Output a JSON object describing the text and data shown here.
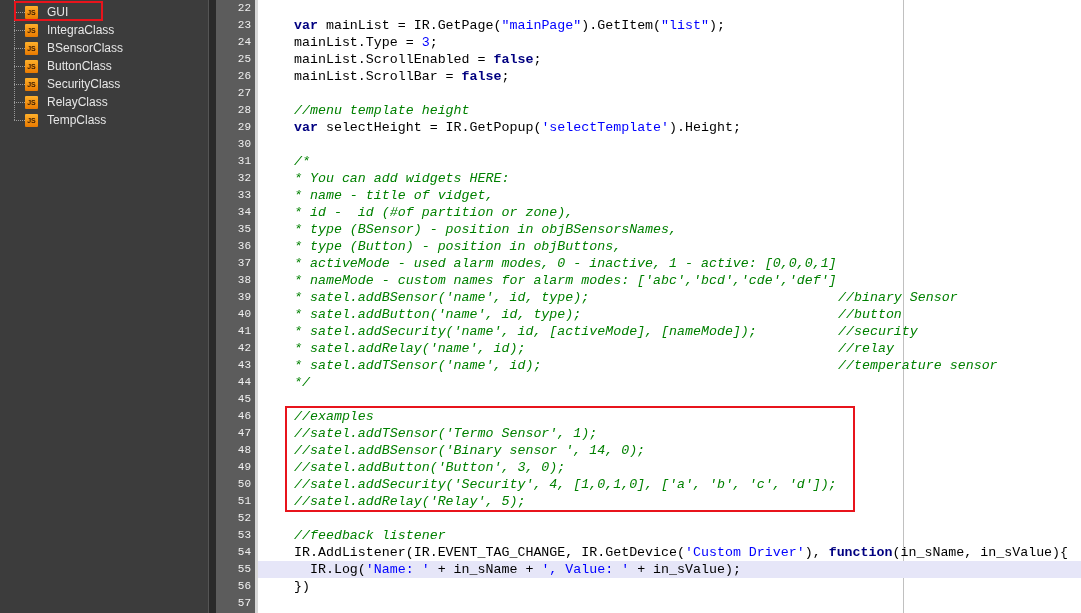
{
  "project_tree": {
    "items": [
      {
        "label": "GUI",
        "icon_text": "JS",
        "boxed": true
      },
      {
        "label": "IntegraClass",
        "icon_text": "JS",
        "boxed": false
      },
      {
        "label": "BSensorClass",
        "icon_text": "JS",
        "boxed": false
      },
      {
        "label": "ButtonClass",
        "icon_text": "JS",
        "boxed": false
      },
      {
        "label": "SecurityClass",
        "icon_text": "JS",
        "boxed": false
      },
      {
        "label": "RelayClass",
        "icon_text": "JS",
        "boxed": false
      },
      {
        "label": "TempClass",
        "icon_text": "JS",
        "boxed": false
      }
    ]
  },
  "editor": {
    "lines": [
      {
        "number": "22",
        "current": false,
        "boxed": false
      },
      {
        "number": "23",
        "current": false,
        "boxed": false,
        "tokens": [
          {
            "kind": "keyword",
            "text": "var"
          },
          {
            "kind": "plain",
            "text": " mainList = IR.GetPage("
          },
          {
            "kind": "string",
            "text": "\"mainPage\""
          },
          {
            "kind": "plain",
            "text": ").GetItem("
          },
          {
            "kind": "string",
            "text": "\"list\""
          },
          {
            "kind": "plain",
            "text": ");"
          }
        ]
      },
      {
        "number": "24",
        "current": false,
        "boxed": false,
        "tokens": [
          {
            "kind": "plain",
            "text": "mainList.Type = "
          },
          {
            "kind": "number",
            "text": "3"
          },
          {
            "kind": "plain",
            "text": ";"
          }
        ]
      },
      {
        "number": "25",
        "current": false,
        "boxed": false,
        "tokens": [
          {
            "kind": "plain",
            "text": "mainList.ScrollEnabled = "
          },
          {
            "kind": "keyword",
            "text": "false"
          },
          {
            "kind": "plain",
            "text": ";"
          }
        ]
      },
      {
        "number": "26",
        "current": false,
        "boxed": false,
        "tokens": [
          {
            "kind": "plain",
            "text": "mainList.ScrollBar = "
          },
          {
            "kind": "keyword",
            "text": "false"
          },
          {
            "kind": "plain",
            "text": ";"
          }
        ]
      },
      {
        "number": "27",
        "current": false,
        "boxed": false
      },
      {
        "number": "28",
        "current": false,
        "boxed": false,
        "tokens": [
          {
            "kind": "comment",
            "text": "//menu template height"
          }
        ]
      },
      {
        "number": "29",
        "current": false,
        "boxed": false,
        "tokens": [
          {
            "kind": "keyword",
            "text": "var"
          },
          {
            "kind": "plain",
            "text": " selectHeight = IR.GetPopup("
          },
          {
            "kind": "string",
            "text": "'selectTemplate'"
          },
          {
            "kind": "plain",
            "text": ").Height;"
          }
        ]
      },
      {
        "number": "30",
        "current": false,
        "boxed": false
      },
      {
        "number": "31",
        "current": false,
        "boxed": false,
        "tokens": [
          {
            "kind": "comment",
            "text": "/*"
          }
        ]
      },
      {
        "number": "32",
        "current": false,
        "boxed": false,
        "tokens": [
          {
            "kind": "comment",
            "text": "* You can add widgets HERE:"
          }
        ]
      },
      {
        "number": "33",
        "current": false,
        "boxed": false,
        "tokens": [
          {
            "kind": "comment",
            "text": "* name - title of vidget,"
          }
        ]
      },
      {
        "number": "34",
        "current": false,
        "boxed": false,
        "tokens": [
          {
            "kind": "comment",
            "text": "* id -  id (#of partition or zone),"
          }
        ]
      },
      {
        "number": "35",
        "current": false,
        "boxed": false,
        "tokens": [
          {
            "kind": "comment",
            "text": "* type (BSensor) - position in objBSensorsNames,"
          }
        ]
      },
      {
        "number": "36",
        "current": false,
        "boxed": false,
        "tokens": [
          {
            "kind": "comment",
            "text": "* type (Button) - position in objButtons,"
          }
        ]
      },
      {
        "number": "37",
        "current": false,
        "boxed": false,
        "tokens": [
          {
            "kind": "comment",
            "text": "* activeMode - used alarm modes, 0 - inactive, 1 - active: [0,0,0,1]"
          }
        ]
      },
      {
        "number": "38",
        "current": false,
        "boxed": false,
        "tokens": [
          {
            "kind": "comment",
            "text": "* nameMode - custom names for alarm modes: ['abc','bcd','cde','def']"
          }
        ]
      },
      {
        "number": "39",
        "current": false,
        "boxed": false,
        "tokens": [
          {
            "kind": "comment",
            "text": "* satel.addBSensor('name', id, type);"
          }
        ],
        "trailing_comment": "//binary Sensor"
      },
      {
        "number": "40",
        "current": false,
        "boxed": false,
        "tokens": [
          {
            "kind": "comment",
            "text": "* satel.addButton('name', id, type);"
          }
        ],
        "trailing_comment": "//button"
      },
      {
        "number": "41",
        "current": false,
        "boxed": false,
        "tokens": [
          {
            "kind": "comment",
            "text": "* satel.addSecurity('name', id, [activeMode], [nameMode]);"
          }
        ],
        "trailing_comment": "//security"
      },
      {
        "number": "42",
        "current": false,
        "boxed": false,
        "tokens": [
          {
            "kind": "comment",
            "text": "* satel.addRelay('name', id);"
          }
        ],
        "trailing_comment": "//relay"
      },
      {
        "number": "43",
        "current": false,
        "boxed": false,
        "tokens": [
          {
            "kind": "comment",
            "text": "* satel.addTSensor('name', id);"
          }
        ],
        "trailing_comment": "//temperature sensor"
      },
      {
        "number": "44",
        "current": false,
        "boxed": false,
        "tokens": [
          {
            "kind": "comment",
            "text": "*/"
          }
        ]
      },
      {
        "number": "45",
        "current": false,
        "boxed": false
      },
      {
        "number": "46",
        "current": false,
        "boxed": true,
        "tokens": [
          {
            "kind": "comment",
            "text": "//examples"
          }
        ]
      },
      {
        "number": "47",
        "current": false,
        "boxed": true,
        "tokens": [
          {
            "kind": "comment",
            "text": "//satel.addTSensor('Termo Sensor', 1);"
          }
        ]
      },
      {
        "number": "48",
        "current": false,
        "boxed": true,
        "tokens": [
          {
            "kind": "comment",
            "text": "//satel.addBSensor('Binary sensor ', 14, 0);"
          }
        ]
      },
      {
        "number": "49",
        "current": false,
        "boxed": true,
        "tokens": [
          {
            "kind": "comment",
            "text": "//satel.addButton('Button', 3, 0);"
          }
        ]
      },
      {
        "number": "50",
        "current": false,
        "boxed": true,
        "tokens": [
          {
            "kind": "comment",
            "text": "//satel.addSecurity('Security', 4, [1,0,1,0], ['a', 'b', 'c', 'd']);"
          }
        ]
      },
      {
        "number": "51",
        "current": false,
        "boxed": true,
        "tokens": [
          {
            "kind": "comment",
            "text": "//satel.addRelay('Relay', 5);"
          }
        ]
      },
      {
        "number": "52",
        "current": false,
        "boxed": false
      },
      {
        "number": "53",
        "current": false,
        "boxed": false,
        "tokens": [
          {
            "kind": "comment",
            "text": "//feedback listener"
          }
        ]
      },
      {
        "number": "54",
        "current": false,
        "boxed": false,
        "tokens": [
          {
            "kind": "plain",
            "text": "IR.AddListener(IR.EVENT_TAG_CHANGE, IR.GetDevice("
          },
          {
            "kind": "string",
            "text": "'Custom Driver'"
          },
          {
            "kind": "plain",
            "text": "), "
          },
          {
            "kind": "keyword",
            "text": "function"
          },
          {
            "kind": "plain",
            "text": "(in_sName, in_sValue){"
          }
        ]
      },
      {
        "number": "55",
        "current": true,
        "boxed": false,
        "tokens": [
          {
            "kind": "plain",
            "text": "  IR.Log("
          },
          {
            "kind": "string",
            "text": "'Name: '"
          },
          {
            "kind": "plain",
            "text": " + in_sName + "
          },
          {
            "kind": "string",
            "text": "', Value: '"
          },
          {
            "kind": "plain",
            "text": " + in_sValue);"
          }
        ]
      },
      {
        "number": "56",
        "current": false,
        "boxed": false,
        "tokens": [
          {
            "kind": "plain",
            "text": "})"
          }
        ]
      },
      {
        "number": "57",
        "current": false,
        "boxed": false
      }
    ]
  }
}
